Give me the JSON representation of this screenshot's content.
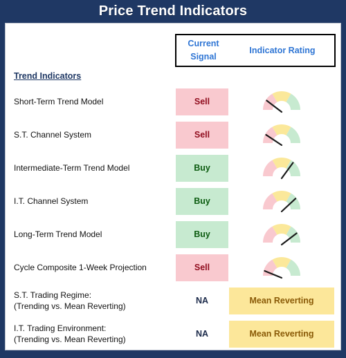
{
  "window": {
    "title": "Price Trend Indicators"
  },
  "colors": {
    "frame_navy": "#1f3864",
    "header_blue": "#2e75d4",
    "sell_bg": "#f9c9cf",
    "sell_fg": "#900d1e",
    "buy_bg": "#c7ead0",
    "buy_fg": "#0d5c11",
    "pill_bg": "#fce79a",
    "pill_fg": "#8a5a07",
    "gauge_red": "#f9c9cf",
    "gauge_yellow": "#fbe89a",
    "gauge_green": "#c7ead0",
    "needle": "#1a1a1a"
  },
  "table": {
    "column_headers": {
      "signal_line1": "Current",
      "signal_line2": "Signal",
      "rating": "Indicator Rating"
    },
    "section_heading": "Trend Indicators",
    "rows": [
      {
        "label_line1": "Short-Term Trend Model",
        "label_line2": "",
        "signal": "Sell",
        "signal_type": "sell",
        "rating_type": "gauge",
        "needle_deg": -58,
        "rating_text": ""
      },
      {
        "label_line1": "S.T. Channel System",
        "label_line2": "",
        "signal": "Sell",
        "signal_type": "sell",
        "rating_type": "gauge",
        "needle_deg": -62,
        "rating_text": ""
      },
      {
        "label_line1": "Intermediate-Term Trend Model",
        "label_line2": "",
        "signal": "Buy",
        "signal_type": "buy",
        "rating_type": "gauge",
        "needle_deg": 40,
        "rating_text": ""
      },
      {
        "label_line1": "I.T. Channel System",
        "label_line2": "",
        "signal": "Buy",
        "signal_type": "buy",
        "rating_type": "gauge",
        "needle_deg": 52,
        "rating_text": ""
      },
      {
        "label_line1": "Long-Term Trend Model",
        "label_line2": "",
        "signal": "Buy",
        "signal_type": "buy",
        "rating_type": "gauge",
        "needle_deg": 58,
        "rating_text": ""
      },
      {
        "label_line1": "Cycle Composite 1-Week Projection",
        "label_line2": "",
        "signal": "Sell",
        "signal_type": "sell",
        "rating_type": "gauge",
        "needle_deg": -74,
        "rating_text": ""
      },
      {
        "label_line1": "S.T. Trading Regime:",
        "label_line2": "(Trending vs. Mean Reverting)",
        "signal": "NA",
        "signal_type": "na",
        "rating_type": "pill",
        "needle_deg": 0,
        "rating_text": "Mean Reverting"
      },
      {
        "label_line1": "I.T. Trading Environment:",
        "label_line2": "(Trending vs. Mean Reverting)",
        "signal": "NA",
        "signal_type": "na",
        "rating_type": "pill",
        "needle_deg": 0,
        "rating_text": "Mean Reverting"
      }
    ]
  }
}
